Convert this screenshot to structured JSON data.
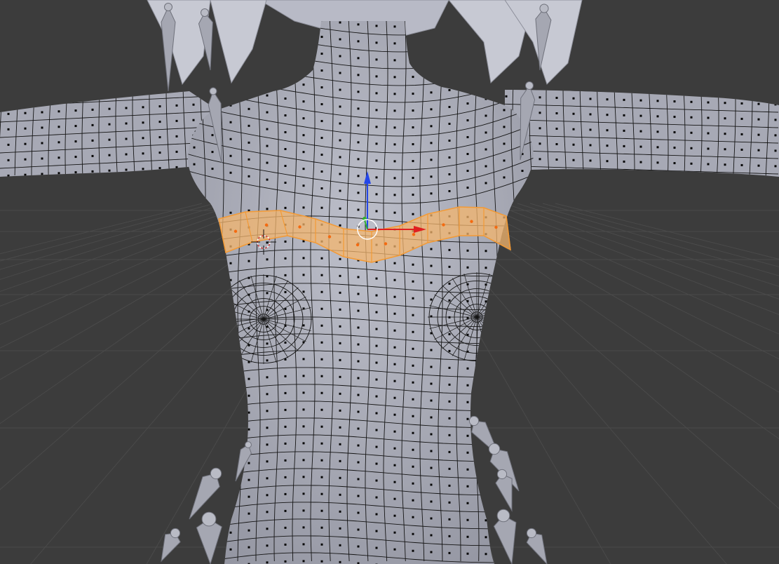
{
  "viewport": {
    "mode": "edit-mode-face-select",
    "background_color": "#3c3c3c",
    "grid_color": "#4a4a4a",
    "mesh_color": "#a9abb6",
    "wire_color": "#141414",
    "selection_color": "#f39a35",
    "selection_fill": "#f4b56e",
    "cursor_color": "#cc3a3a",
    "gizmo": {
      "x_color": "#e02020",
      "y_color": "#2fb12f",
      "z_color": "#2447e8"
    }
  }
}
